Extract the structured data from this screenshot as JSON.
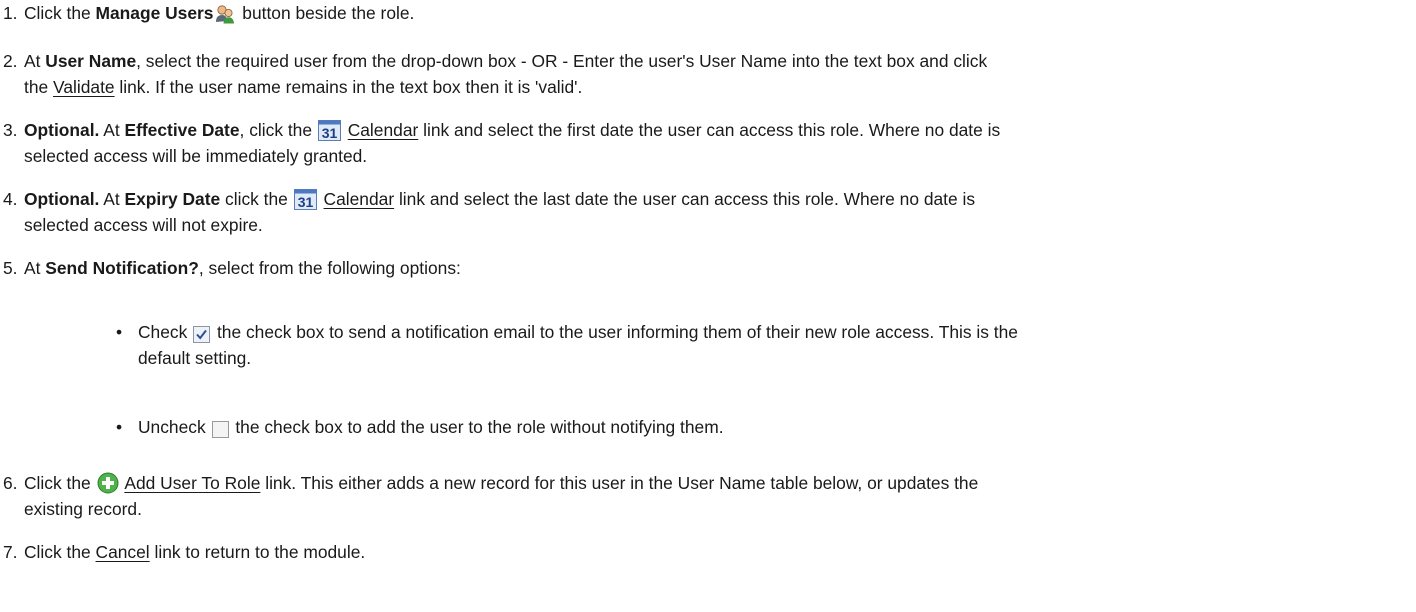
{
  "steps": [
    {
      "num": "1.",
      "segments": [
        {
          "t": "Click the "
        },
        {
          "t": "Manage Users",
          "b": true
        },
        {
          "icon": "manage-users-icon"
        },
        {
          "t": " button beside the role."
        }
      ]
    },
    {
      "num": "2.",
      "segments": [
        {
          "t": " At "
        },
        {
          "t": "User Name",
          "b": true
        },
        {
          "t": ", select the required user from the drop-down box - OR - Enter the user's User Name into the text box and click"
        },
        {
          "br": true
        },
        {
          "t": "the "
        },
        {
          "t": "Validate",
          "link": true
        },
        {
          "t": " link. If the user name remains in the text box then it is 'valid'."
        }
      ]
    },
    {
      "num": "3.",
      "segments": [
        {
          "t": "Optional.",
          "b": true
        },
        {
          "t": " At "
        },
        {
          "t": "Effective Date",
          "b": true
        },
        {
          "t": ", click the "
        },
        {
          "icon": "calendar-icon"
        },
        {
          "t": " "
        },
        {
          "t": "Calendar",
          "link": true
        },
        {
          "t": " link and select the first date the user can access this role. Where no date is"
        },
        {
          "br": true
        },
        {
          "t": "selected access will be immediately granted."
        }
      ]
    },
    {
      "num": "4.",
      "segments": [
        {
          "t": "Optional.",
          "b": true
        },
        {
          "t": " At "
        },
        {
          "t": "Expiry Date",
          "b": true
        },
        {
          "t": " click the "
        },
        {
          "icon": "calendar-icon"
        },
        {
          "t": " "
        },
        {
          "t": "Calendar",
          "link": true
        },
        {
          "t": " link and select the last date the user can access this role. Where no date is"
        },
        {
          "br": true
        },
        {
          "t": "selected access will not expire."
        }
      ]
    },
    {
      "num": "5.",
      "segments": [
        {
          "t": "At "
        },
        {
          "t": "Send Notification?",
          "b": true
        },
        {
          "t": ", select from the following options:"
        }
      ]
    },
    {
      "num": "6.",
      "segments": [
        {
          "t": "Click the "
        },
        {
          "icon": "add-icon"
        },
        {
          "t": " "
        },
        {
          "t": "Add User To Role",
          "link": true
        },
        {
          "t": " link. This either adds a new record for this user in the User Name table below, or updates the"
        },
        {
          "br": true
        },
        {
          "t": "existing record."
        }
      ]
    },
    {
      "num": "7.",
      "segments": [
        {
          "t": "Click the "
        },
        {
          "t": "Cancel",
          "link": true
        },
        {
          "t": " link to return to the module."
        }
      ]
    }
  ],
  "options": [
    {
      "segments": [
        {
          "t": "Check "
        },
        {
          "icon": "checkbox-checked-icon"
        },
        {
          "t": " the check box to send a notification email to the user informing them of their new role access. This is the"
        },
        {
          "br": true
        },
        {
          "t": "default setting."
        }
      ]
    },
    {
      "segments": [
        {
          "t": "Uncheck "
        },
        {
          "icon": "checkbox-unchecked-icon"
        },
        {
          "t": " the check box to add the user to the role without notifying them."
        }
      ]
    }
  ],
  "bullet_glyph": "•"
}
